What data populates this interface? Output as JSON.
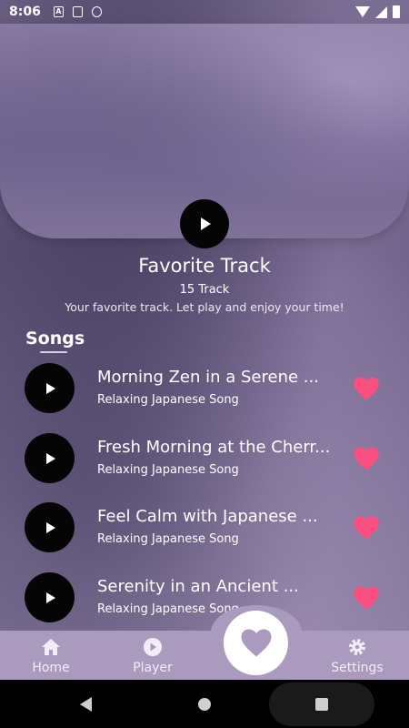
{
  "status_bar": {
    "time": "8:06",
    "icons": [
      "a-icon",
      "sd-card-icon",
      "sync-icon"
    ],
    "right_icons": [
      "wifi-icon",
      "signal-icon",
      "battery-icon"
    ]
  },
  "playlist": {
    "title": "Favorite Track",
    "count": "15 Track",
    "description": "Your favorite track. Let play and enjoy your time!"
  },
  "songs_heading": "Songs",
  "songs": [
    {
      "title": "Morning Zen in a Serene ...",
      "subtitle": "Relaxing Japanese Song",
      "favorite": true
    },
    {
      "title": "Fresh Morning at the Cherr...",
      "subtitle": "Relaxing Japanese Song",
      "favorite": true
    },
    {
      "title": "Feel Calm with Japanese ...",
      "subtitle": "Relaxing Japanese Song",
      "favorite": true
    },
    {
      "title": "Serenity in an Ancient ...",
      "subtitle": "Relaxing Japanese Song",
      "favorite": true
    }
  ],
  "bottom_nav": {
    "home": "Home",
    "player": "Player",
    "settings": "Settings",
    "center_icon": "heart-icon"
  },
  "colors": {
    "heart": "#fb4f80",
    "nav_background": "#a99abe",
    "play_button": "#050505"
  }
}
